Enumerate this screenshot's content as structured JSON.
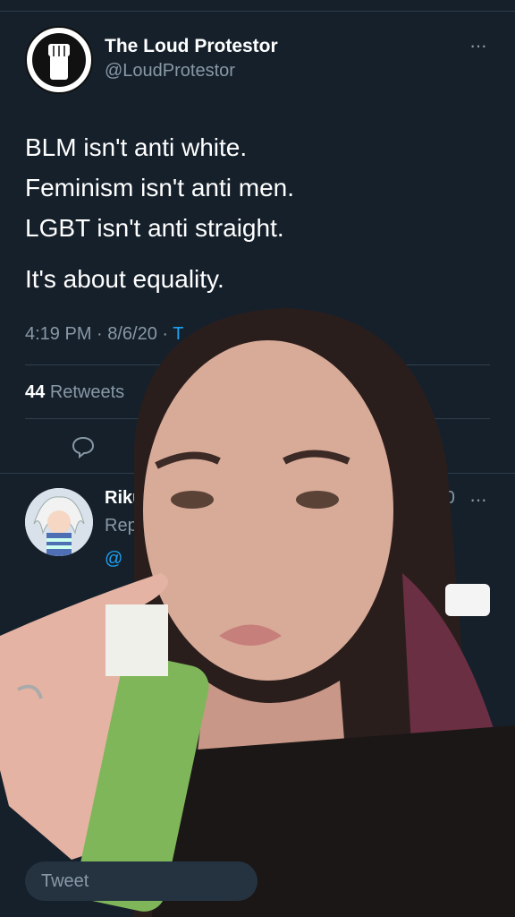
{
  "tweet": {
    "author_name": "The Loud Protestor",
    "author_handle": "@LoudProtestor",
    "more_label": "···",
    "lines": [
      "BLM isn't anti white.",
      "Feminism isn't anti men.",
      "LGBT isn't anti straight."
    ],
    "closing": "It's about equality.",
    "timestamp": "4:19 PM · 8/6/20 · ",
    "timestamp_source": "T"
  },
  "stats": {
    "retweets_count": "44",
    "retweets_label": "Retweets"
  },
  "actions": {
    "reply_icon": "comment-icon",
    "share_icon": "share-icon"
  },
  "reply": {
    "author_name": "Riku",
    "subtitle": "Rep",
    "mention": "@",
    "date": "1/20",
    "more_label": "···"
  },
  "compose": {
    "placeholder": "Tweet"
  },
  "colors": {
    "background": "#15202b",
    "muted_text": "#8899a6",
    "accent": "#1da1f2",
    "divider": "#2f3e4d"
  }
}
